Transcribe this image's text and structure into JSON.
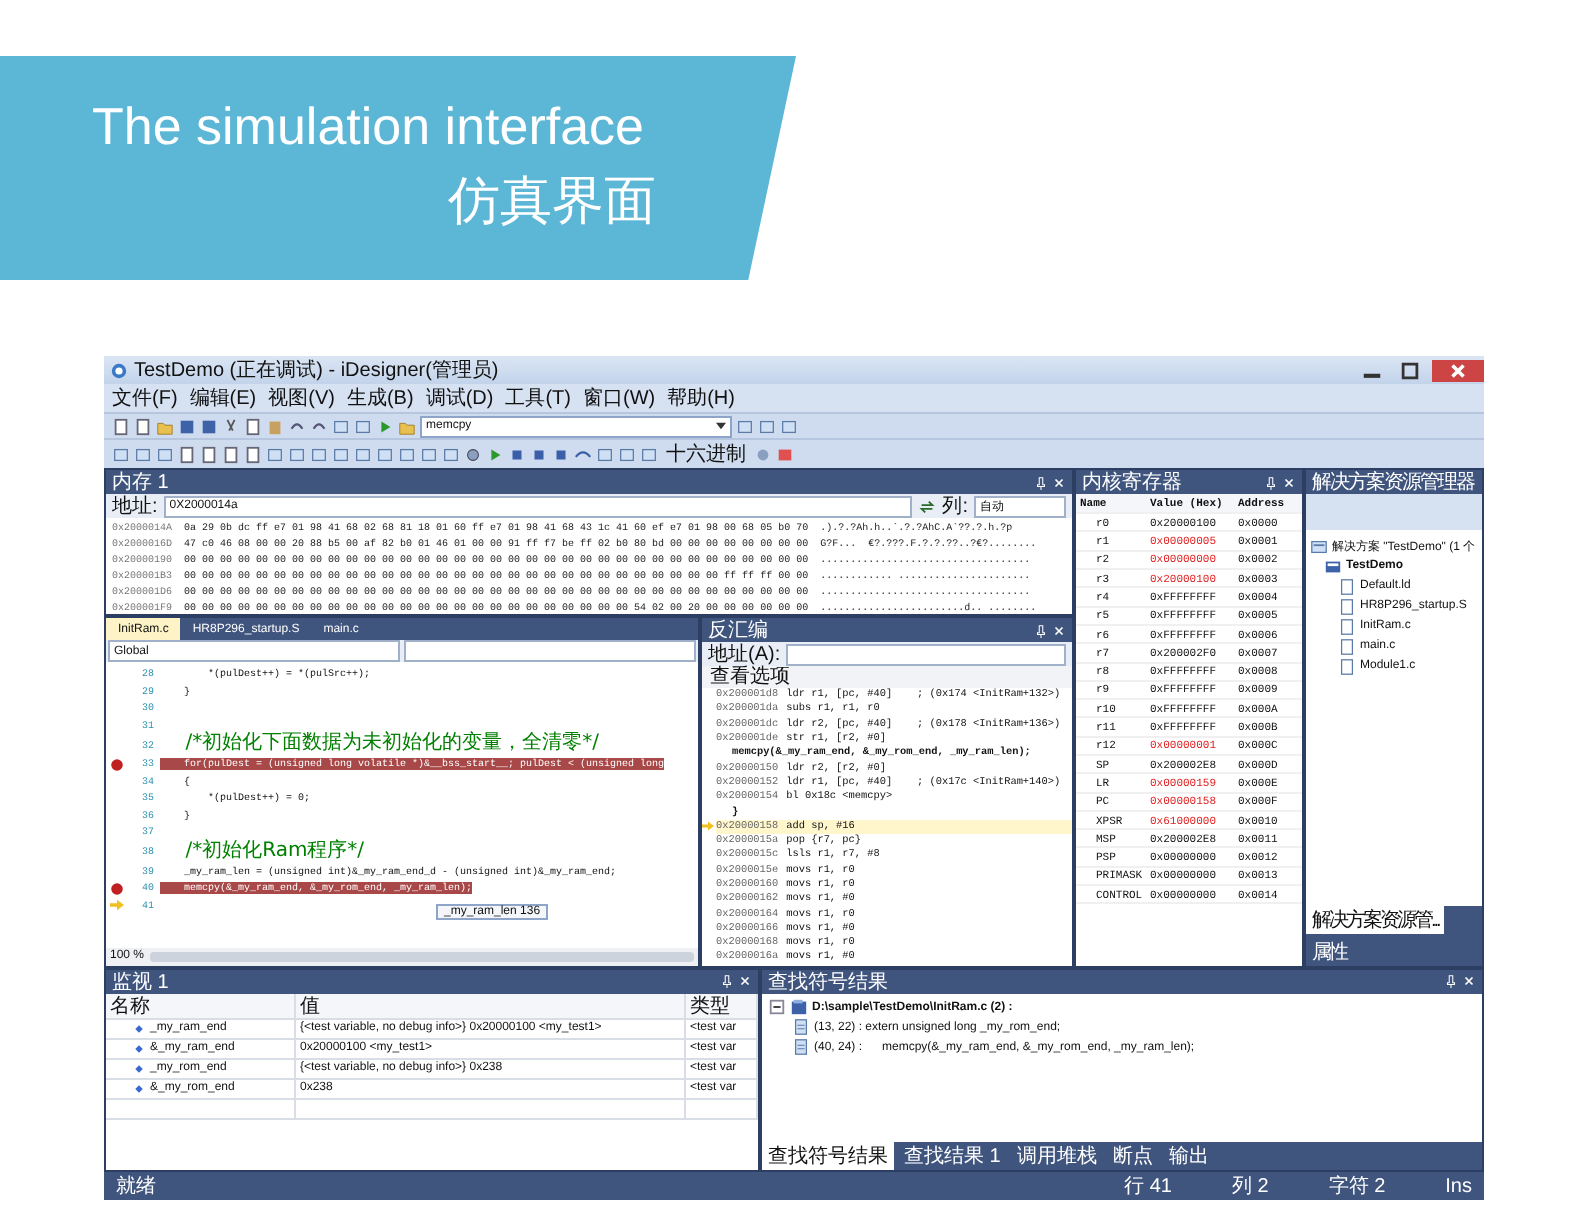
{
  "banner": {
    "title": "The simulation interface",
    "subtitle": "仿真界面"
  },
  "window": {
    "title": "TestDemo (正在调试) - iDesigner(管理员)"
  },
  "menu": [
    "文件(F)",
    "编辑(E)",
    "视图(V)",
    "生成(B)",
    "调试(D)",
    "工具(T)",
    "窗口(W)",
    "帮助(H)"
  ],
  "toolbar": {
    "search_combo": "memcpy",
    "hex_button": "十六进制"
  },
  "memory_panel": {
    "title": "内存 1",
    "address_label": "地址:",
    "address": "0X2000014a",
    "columns_label": "列:",
    "columns": "自动",
    "rows": [
      {
        "address": "0x2000014A",
        "bytes": "0a 29 0b dc ff e7 01 98 41 68 02 68 81 18 01 60 ff e7 01 98 41 68 43 1c 41 60 ef e7 01 98 00 68 05 b0 70",
        "ascii": ".).?.?Ah.h..`.?.?AhC.A`??.?.h.?p"
      },
      {
        "address": "0x2000016D",
        "bytes": "47 c0 46 08 00 00 20 88 b5 00 af 82 b0 01 46 01 00 00 91 ff f7 be ff 02 b0 80 bd 00 00 00 00 00 00 00 00",
        "ascii": "G?F...  €?.???.F.?.?.??..?€?........"
      },
      {
        "address": "0x20000190",
        "bytes": "00 00 00 00 00 00 00 00 00 00 00 00 00 00 00 00 00 00 00 00 00 00 00 00 00 00 00 00 00 00 00 00 00 00 00",
        "ascii": "..................................."
      },
      {
        "address": "0x200001B3",
        "bytes": "00 00 00 00 00 00 00 00 00 00 00 00 00 00 00 00 00 00 00 00 00 00 00 00 00 00 00 00 00 00 ff ff ff 00 00",
        "ascii": "............ ......................"
      },
      {
        "address": "0x200001D6",
        "bytes": "00 00 00 00 00 00 00 00 00 00 00 00 00 00 00 00 00 00 00 00 00 00 00 00 00 00 00 00 00 00 00 00 00 00 00",
        "ascii": "..................................."
      },
      {
        "address": "0x200001F9",
        "bytes": "00 00 00 00 00 00 00 00 00 00 00 00 00 00 00 00 00 00 00 00 00 00 00 00 00 54 02 00 20 00 00 00 00 00 00",
        "ascii": "........................d.. ........"
      }
    ]
  },
  "editor": {
    "tabs": [
      {
        "label": "InitRam.c",
        "selected": true
      },
      {
        "label": "HR8P296_startup.S",
        "selected": false
      },
      {
        "label": "main.c",
        "selected": false
      }
    ],
    "scope": "Global",
    "zoom": "100 %",
    "lines": [
      {
        "number": "28",
        "kind": "normal",
        "text": "        *(pulDest++) = *(pulSrc++);"
      },
      {
        "number": "29",
        "kind": "normal",
        "text": "    }"
      },
      {
        "number": "30",
        "kind": "normal"
      },
      {
        "number": "31",
        "kind": "normal"
      },
      {
        "number": "32",
        "kind": "comment",
        "text": "    /*初始化下面数据为未初始化的变量，全清零*/"
      },
      {
        "number": "33",
        "kind": "breakpoint",
        "text": "    for(pulDest = (unsigned long volatile *)&__bss_start__; pulDest < (unsigned long"
      },
      {
        "number": "34",
        "kind": "normal",
        "text": "    {"
      },
      {
        "number": "35",
        "kind": "normal",
        "text": "        *(pulDest++) = 0;"
      },
      {
        "number": "36",
        "kind": "normal",
        "text": "    }"
      },
      {
        "number": "37",
        "kind": "normal"
      },
      {
        "number": "38",
        "kind": "comment",
        "text": "    /*初始化Ram程序*/"
      },
      {
        "number": "39",
        "kind": "normal",
        "text": "    _my_ram_len = (unsigned int)&_my_ram_end_d - (unsigned int)&_my_ram_end;"
      },
      {
        "number": "40",
        "kind": "breakpoint",
        "text": "    memcpy(&_my_ram_end, &_my_rom_end, _my_ram_len);"
      },
      {
        "number": "41",
        "kind": "current"
      }
    ],
    "tooltip": {
      "name": "_my_ram_len",
      "value": "136"
    }
  },
  "disassembly": {
    "title": "反汇编",
    "address_label": "地址(A):",
    "options": "查看选项",
    "lines": [
      {
        "kind": "asm",
        "address": "0x200001d8",
        "text": "ldr r1, [pc, #40]    ; (0x174 <InitRam+132>)"
      },
      {
        "kind": "asm",
        "address": "0x200001da",
        "text": "subs r1, r1, r0"
      },
      {
        "kind": "asm",
        "address": "0x200001dc",
        "text": "ldr r2, [pc, #40]    ; (0x178 <InitRam+136>)"
      },
      {
        "kind": "asm",
        "address": "0x200001de",
        "text": "str r1, [r2, #0]"
      },
      {
        "kind": "source",
        "text": "memcpy(&_my_ram_end, &_my_rom_end, _my_ram_len);"
      },
      {
        "kind": "asm",
        "address": "0x20000150",
        "text": "ldr r2, [r2, #0]"
      },
      {
        "kind": "asm",
        "address": "0x20000152",
        "text": "ldr r1, [pc, #40]    ; (0x17c <InitRam+140>)"
      },
      {
        "kind": "asm",
        "address": "0x20000154",
        "text": "bl 0x18c <memcpy>"
      },
      {
        "kind": "source",
        "text": "}"
      },
      {
        "kind": "current",
        "address": "0x20000158",
        "text": "add sp, #16"
      },
      {
        "kind": "asm",
        "address": "0x2000015a",
        "text": "pop {r7, pc}"
      },
      {
        "kind": "asm",
        "address": "0x2000015c",
        "text": "lsls r1, r7, #8"
      },
      {
        "kind": "asm",
        "address": "0x2000015e",
        "text": "movs r1, r0"
      },
      {
        "kind": "asm",
        "address": "0x20000160",
        "text": "movs r1, r0"
      },
      {
        "kind": "asm",
        "address": "0x20000162",
        "text": "movs r1, #0"
      },
      {
        "kind": "asm",
        "address": "0x20000164",
        "text": "movs r1, r0"
      },
      {
        "kind": "asm",
        "address": "0x20000166",
        "text": "movs r1, #0"
      },
      {
        "kind": "asm",
        "address": "0x20000168",
        "text": "movs r1, r0"
      },
      {
        "kind": "asm",
        "address": "0x2000016a",
        "text": "movs r1, #0"
      }
    ]
  },
  "registers": {
    "title": "内核寄存器",
    "columns": [
      "Name",
      "Value (Hex)",
      "Address"
    ],
    "rows": [
      {
        "name": "r0",
        "value": "0x20000100",
        "address": "0x0000",
        "changed": false
      },
      {
        "name": "r1",
        "value": "0x00000005",
        "address": "0x0001",
        "changed": true
      },
      {
        "name": "r2",
        "value": "0x00000000",
        "address": "0x0002",
        "changed": true
      },
      {
        "name": "r3",
        "value": "0x20000100",
        "address": "0x0003",
        "changed": true
      },
      {
        "name": "r4",
        "value": "0xFFFFFFFF",
        "address": "0x0004",
        "changed": false
      },
      {
        "name": "r5",
        "value": "0xFFFFFFFF",
        "address": "0x0005",
        "changed": false
      },
      {
        "name": "r6",
        "value": "0xFFFFFFFF",
        "address": "0x0006",
        "changed": false
      },
      {
        "name": "r7",
        "value": "0x200002F0",
        "address": "0x0007",
        "changed": false
      },
      {
        "name": "r8",
        "value": "0xFFFFFFFF",
        "address": "0x0008",
        "changed": false
      },
      {
        "name": "r9",
        "value": "0xFFFFFFFF",
        "address": "0x0009",
        "changed": false
      },
      {
        "name": "r10",
        "value": "0xFFFFFFFF",
        "address": "0x000A",
        "changed": false
      },
      {
        "name": "r11",
        "value": "0xFFFFFFFF",
        "address": "0x000B",
        "changed": false
      },
      {
        "name": "r12",
        "value": "0x00000001",
        "address": "0x000C",
        "changed": true
      },
      {
        "name": "SP",
        "value": "0x200002E8",
        "address": "0x000D",
        "changed": false
      },
      {
        "name": "LR",
        "value": "0x00000159",
        "address": "0x000E",
        "changed": true
      },
      {
        "name": "PC",
        "value": "0x00000158",
        "address": "0x000F",
        "changed": true
      },
      {
        "name": "XPSR",
        "value": "0x61000000",
        "address": "0x0010",
        "changed": true
      },
      {
        "name": "MSP",
        "value": "0x200002E8",
        "address": "0x0011",
        "changed": false
      },
      {
        "name": "PSP",
        "value": "0x00000000",
        "address": "0x0012",
        "changed": false
      },
      {
        "name": "PRIMASK",
        "value": "0x00000000",
        "address": "0x0013",
        "changed": false
      },
      {
        "name": "CONTROL",
        "value": "0x00000000",
        "address": "0x0014",
        "changed": false
      }
    ]
  },
  "solution": {
    "title": "解决方案资源管理器",
    "tree": [
      {
        "label": "解决方案 \"TestDemo\" (1 个",
        "kind": "solution",
        "children": [
          {
            "label": "TestDemo",
            "kind": "project",
            "children": [
              {
                "label": "Default.ld",
                "kind": "file"
              },
              {
                "label": "HR8P296_startup.S",
                "kind": "file"
              },
              {
                "label": "InitRam.c",
                "kind": "file"
              },
              {
                "label": "main.c",
                "kind": "file"
              },
              {
                "label": "Module1.c",
                "kind": "file"
              }
            ]
          }
        ]
      }
    ],
    "tabs": [
      {
        "label": "解决方案资源管...",
        "selected": true
      },
      {
        "label": "属性",
        "selected": false
      }
    ]
  },
  "watch": {
    "title": "监视 1",
    "columns": [
      "名称",
      "值",
      "类型"
    ],
    "rows": [
      {
        "name": "_my_ram_end",
        "value": "{<test variable, no debug info>} 0x20000100 <my_test1>",
        "type": "<test var"
      },
      {
        "name": "&_my_ram_end",
        "value": "0x20000100 <my_test1>",
        "type": "<test var"
      },
      {
        "name": "_my_rom_end",
        "value": "{<test variable, no debug info>} 0x238",
        "type": "<test var"
      },
      {
        "name": "&_my_rom_end",
        "value": "0x238",
        "type": "<test var"
      }
    ]
  },
  "find_results": {
    "title": "查找符号结果",
    "tree": [
      {
        "label": "D:\\sample\\TestDemo\\InitRam.c (2) :",
        "kind": "folder",
        "children": [
          {
            "label": "(13, 22) : extern unsigned long _my_rom_end;",
            "kind": "result"
          },
          {
            "label": "(40, 24) :      memcpy(&_my_ram_end, &_my_rom_end, _my_ram_len);",
            "kind": "result"
          }
        ]
      }
    ],
    "tabs": [
      {
        "label": "查找符号结果",
        "selected": true
      },
      {
        "label": "查找结果 1",
        "selected": false
      },
      {
        "label": "调用堆栈",
        "selected": false
      },
      {
        "label": "断点",
        "selected": false
      },
      {
        "label": "输出",
        "selected": false
      }
    ]
  },
  "status_bar": {
    "text": "就绪",
    "line": "行 41",
    "column": "列 2",
    "char": "字符 2",
    "mode": "Ins"
  }
}
